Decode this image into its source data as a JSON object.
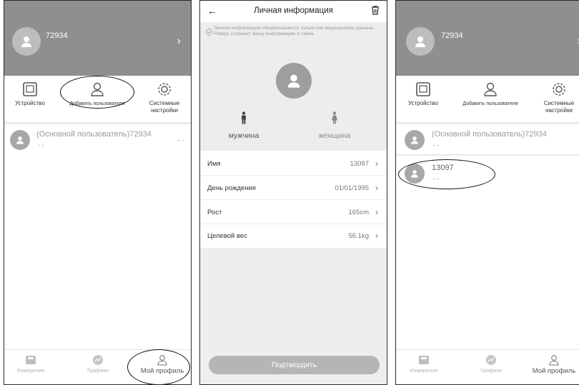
{
  "profile_screen_1": {
    "user_id": "72934",
    "quick_actions": [
      "Устройство",
      "Добавить пользователя",
      "Системные настройки"
    ],
    "users": [
      {
        "label": "(Основной пользователь)72934",
        "sub": "- -",
        "value": "- -"
      }
    ]
  },
  "personal_info": {
    "title": "Личная информация",
    "notice": "Личная информация обрабатывается только как медицинские данные. Fitdays сохранит вашу информацию в тайне",
    "gender_male": "мужчина",
    "gender_female": "женщина",
    "fields": [
      {
        "label": "Имя",
        "value": "13097"
      },
      {
        "label": "День рождения",
        "value": "01/01/1995"
      },
      {
        "label": "Рост",
        "value": "165cm"
      },
      {
        "label": "Целевой вес",
        "value": "56.1kg"
      }
    ],
    "confirm_label": "Подтвердить"
  },
  "profile_screen_3": {
    "user_id": "72934",
    "quick_actions": [
      "Устройство",
      "Добавить пользователя",
      "Системные настройки"
    ],
    "users": [
      {
        "label": "(Основной пользователь)72934",
        "sub": "- -",
        "value": "- -"
      },
      {
        "label": "13097",
        "sub": "- -",
        "value": "- -"
      }
    ]
  },
  "tabs": [
    "Измерение",
    "Графики",
    "Мой профиль"
  ],
  "colors": {
    "header_gray": "#8f8f8f",
    "panel_gray": "#ededed",
    "button_gray": "#b5b5b5"
  }
}
